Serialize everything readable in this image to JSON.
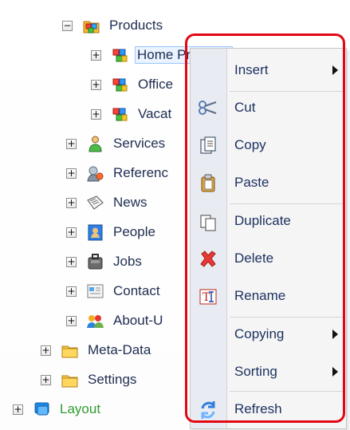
{
  "tree": {
    "products": "Products",
    "home_products": "Home Products",
    "office": "Office",
    "vacation": "Vacat",
    "services": "Services",
    "references": "Referenc",
    "news": "News",
    "people": "People",
    "jobs": "Jobs",
    "contact": "Contact",
    "about_us": "About-U",
    "meta_data": "Meta-Data",
    "settings": "Settings",
    "layout": "Layout"
  },
  "context_menu": {
    "insert": "Insert",
    "cut": "Cut",
    "copy": "Copy",
    "paste": "Paste",
    "duplicate": "Duplicate",
    "delete": "Delete",
    "rename": "Rename",
    "copying": "Copying",
    "sorting": "Sorting",
    "refresh": "Refresh"
  },
  "icons": {
    "folder": "folder-icon",
    "product": "product-cubes-icon",
    "services": "person-icon",
    "references": "reference-icon",
    "news": "news-icon",
    "people": "people-icon",
    "jobs": "jobs-icon",
    "contact": "contact-icon",
    "about": "about-us-icon",
    "layout": "layout-icon"
  },
  "colors": {
    "highlight": "#e30613",
    "menu_text": "#1c315f",
    "selection": "#eaf3ff",
    "layout_text": "#2f9b2f"
  }
}
